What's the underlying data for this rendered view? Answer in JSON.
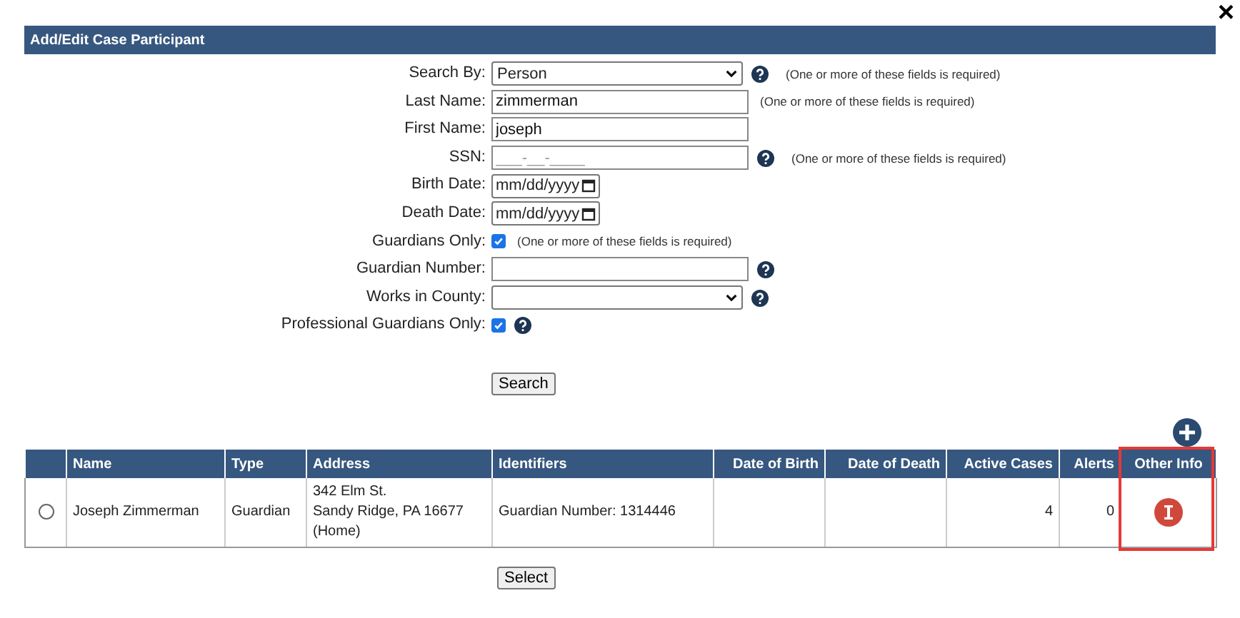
{
  "dialog": {
    "title": "Add/Edit Case Participant",
    "close": "×"
  },
  "form": {
    "fields": [
      {
        "label": "Search By:",
        "kind": "select",
        "value": "Person",
        "help": true,
        "note": "(One or more of these fields is required)"
      },
      {
        "label": "Last Name:",
        "kind": "text",
        "value": "zimmerman",
        "help": false,
        "note": "(One or more of these fields is required)"
      },
      {
        "label": "First Name:",
        "kind": "text",
        "value": "joseph",
        "help": false
      },
      {
        "label": "SSN:",
        "kind": "text",
        "placeholder": "___-__-____",
        "help": true,
        "note": "(One or more of these fields is required)"
      },
      {
        "label": "Birth Date:",
        "kind": "date",
        "placeholder": "mm/dd/yyyy",
        "help": false
      },
      {
        "label": "Death Date:",
        "kind": "date",
        "placeholder": "mm/dd/yyyy",
        "help": false
      },
      {
        "label": "Guardians Only:",
        "kind": "checkbox",
        "checked": true,
        "help": false,
        "note": "(One or more of these fields is required)"
      },
      {
        "label": "Guardian Number:",
        "kind": "text",
        "help": true
      },
      {
        "label": "Works in County:",
        "kind": "select",
        "help": true
      },
      {
        "label": "Professional Guardians Only:",
        "kind": "checkbox",
        "checked": true,
        "help": true
      }
    ],
    "search_button": "Search"
  },
  "table": {
    "columns": [
      {
        "highlighted": false
      },
      {
        "label": "Name",
        "highlighted": false
      },
      {
        "label": "Type",
        "highlighted": false
      },
      {
        "label": "Address",
        "highlighted": false
      },
      {
        "label": "Identifiers",
        "highlighted": false
      },
      {
        "label": "Date of Birth",
        "highlighted": false
      },
      {
        "label": "Date of Death",
        "highlighted": false
      },
      {
        "label": "Active Cases",
        "highlighted": false
      },
      {
        "label": "Alerts",
        "highlighted": false
      },
      {
        "label": "Other Info",
        "highlighted": true
      }
    ],
    "rows": [
      {
        "selected": false,
        "name": "Joseph Zimmerman",
        "type": "Guardian",
        "address": [
          "342 Elm St.",
          "Sandy Ridge, PA 16677",
          "(Home)"
        ],
        "identifiers": "Guardian Number: 1314446",
        "active_cases": "4",
        "alerts": "0",
        "other_info": true
      }
    ]
  },
  "select_button": "Select"
}
